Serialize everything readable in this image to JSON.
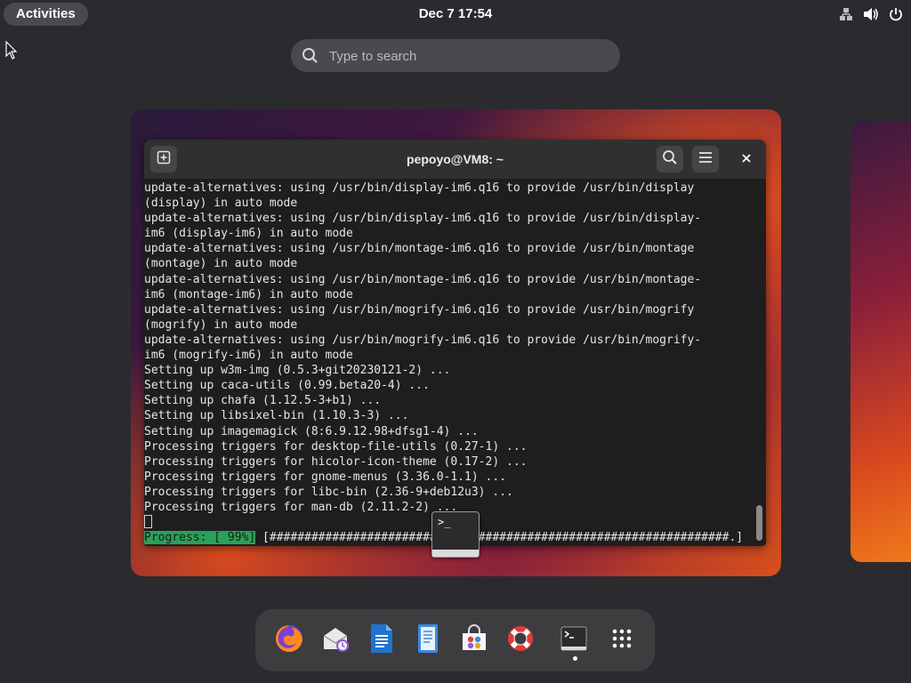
{
  "topbar": {
    "activities_label": "Activities",
    "clock": "Dec 7  17:54",
    "tray_icons": [
      "network-icon",
      "volume-icon",
      "power-icon"
    ]
  },
  "search": {
    "placeholder": "Type to search",
    "icon": "search-icon"
  },
  "terminal": {
    "title": "pepoyo@VM8: ~",
    "new_tab_icon": "new-tab-icon",
    "search_icon": "search-icon",
    "menu_icon": "hamburger-menu-icon",
    "close_icon": "close-icon",
    "lines": [
      "update-alternatives: using /usr/bin/display-im6.q16 to provide /usr/bin/display",
      "(display) in auto mode",
      "update-alternatives: using /usr/bin/display-im6.q16 to provide /usr/bin/display-",
      "im6 (display-im6) in auto mode",
      "update-alternatives: using /usr/bin/montage-im6.q16 to provide /usr/bin/montage",
      "(montage) in auto mode",
      "update-alternatives: using /usr/bin/montage-im6.q16 to provide /usr/bin/montage-",
      "im6 (montage-im6) in auto mode",
      "update-alternatives: using /usr/bin/mogrify-im6.q16 to provide /usr/bin/mogrify",
      "(mogrify) in auto mode",
      "update-alternatives: using /usr/bin/mogrify-im6.q16 to provide /usr/bin/mogrify-",
      "im6 (mogrify-im6) in auto mode",
      "Setting up w3m-img (0.5.3+git20230121-2) ...",
      "Setting up caca-utils (0.99.beta20-4) ...",
      "Setting up chafa (1.12.5-3+b1) ...",
      "Setting up libsixel-bin (1.10.3-3) ...",
      "Setting up imagemagick (8:6.9.12.98+dfsg1-4) ...",
      "Processing triggers for desktop-file-utils (0.27-1) ...",
      "Processing triggers for hicolor-icon-theme (0.17-2) ...",
      "Processing triggers for gnome-menus (3.36.0-1.1) ...",
      "Processing triggers for libc-bin (2.36-9+deb12u3) ...",
      "Processing triggers for man-db (2.11.2-2) ..."
    ],
    "progress_label": "Progress: [ 99%]",
    "progress_bar": " [##################################################################.]",
    "progress_value": 0.99
  },
  "dock": {
    "apps": [
      "Firefox",
      "Evolution",
      "LibreOffice Writer",
      "Text Editor",
      "Software",
      "Help",
      "Terminal",
      "Show Applications"
    ]
  }
}
